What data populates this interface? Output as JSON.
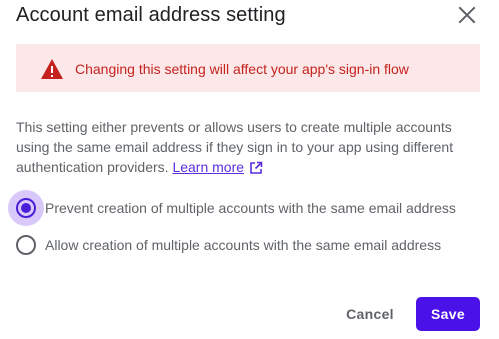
{
  "dialog": {
    "title": "Account email address setting",
    "close_icon": "close-icon"
  },
  "warning": {
    "icon": "warning-icon",
    "text": "Changing this setting will affect your app's sign-in flow",
    "text_color": "#c5221f",
    "background": "#fce8e8"
  },
  "description": {
    "text": "This setting either prevents or allows users to create multiple accounts using the same email address if they sign in to your app using different authentication providers.",
    "link_label": "Learn more",
    "link_icon": "external-link-icon"
  },
  "options": {
    "prevent": {
      "label": "Prevent creation of multiple accounts with the same email address",
      "selected": true
    },
    "allow": {
      "label": "Allow creation of multiple accounts with the same email address",
      "selected": false
    }
  },
  "actions": {
    "cancel_label": "Cancel",
    "save_label": "Save"
  },
  "colors": {
    "accent": "#4a12e8",
    "text_secondary": "#5f6368"
  }
}
